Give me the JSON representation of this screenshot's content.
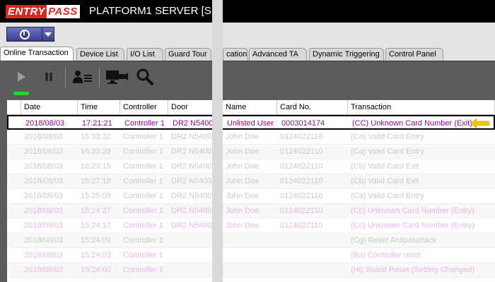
{
  "title": {
    "brand_entry": "ENTRY",
    "brand_pass": "PASS",
    "server": "PLATFORM1 SERVER [S"
  },
  "tabs": [
    {
      "label": "Online Transaction",
      "active": true
    },
    {
      "label": "Device List"
    },
    {
      "label": "I/O List"
    },
    {
      "label": "Guard Tour"
    },
    {
      "label": "cation"
    },
    {
      "label": "Advanced TA"
    },
    {
      "label": "Dynamic Triggering"
    },
    {
      "label": "Control Panel"
    }
  ],
  "columns": [
    "Date",
    "Time",
    "Controller",
    "Door",
    "Name",
    "Card No.",
    "Transaction"
  ],
  "rows": [
    {
      "date": "2018/08/03",
      "time": "17:21:21",
      "controller": "Controller 1",
      "door": "DR2 N5400",
      "name": "Unlisted User",
      "card": "0003014174",
      "transaction": "(CC) Unknown Card Number (Exit)",
      "style": "selected"
    },
    {
      "date": "2018/08/03",
      "time": "16:33:32",
      "controller": "Controller 1",
      "door": "DR2 N5400",
      "name": "John Doe",
      "card": "0124022110",
      "transaction": "(Ca) Valid Card Entry",
      "style": "grey"
    },
    {
      "date": "2018/08/03",
      "time": "16:33:28",
      "controller": "Controller 1",
      "door": "DR2 N5400",
      "name": "John Doe",
      "card": "0124022110",
      "transaction": "(Ca) Valid Card Entry",
      "style": "grey"
    },
    {
      "date": "2018/08/03",
      "time": "16:23:15",
      "controller": "Controller 1",
      "door": "DR2 N5400",
      "name": "John Doe",
      "card": "0124022110",
      "transaction": "(Cb) Valid Card Exit",
      "style": "grey"
    },
    {
      "date": "2018/08/03",
      "time": "15:27:18",
      "controller": "Controller 1",
      "door": "DR2 N5400",
      "name": "John Doe",
      "card": "0124022110",
      "transaction": "(Cb) Valid Card Exit",
      "style": "grey"
    },
    {
      "date": "2018/08/03",
      "time": "15:25:08",
      "controller": "Controller 1",
      "door": "DR2 N5400",
      "name": "John Doe",
      "card": "0124022110",
      "transaction": "(Ca) Valid Card Entry",
      "style": "grey"
    },
    {
      "date": "2018/08/03",
      "time": "15:24:27",
      "controller": "Controller 1",
      "door": "DR2 N5400",
      "name": "John Doe",
      "card": "0124022110",
      "transaction": "(Cc) Unknown Card Number (Entry)",
      "style": "pink"
    },
    {
      "date": "2018/08/03",
      "time": "15:24:17",
      "controller": "Controller 1",
      "door": "DR2 N5400",
      "name": "John Doe",
      "card": "0124022110",
      "transaction": "(Cc) Unknown Card Number (Entry)",
      "style": "pink"
    },
    {
      "date": "2018/08/03",
      "time": "15:24:09",
      "controller": "Controller 1",
      "door": "",
      "name": "",
      "card": "",
      "transaction": "(Cg) Reset Antipassback",
      "style": "grey"
    },
    {
      "date": "2018/08/03",
      "time": "15:24:03",
      "controller": "Controller 1",
      "door": "",
      "name": "",
      "card": "",
      "transaction": "(Ba) Controller reset",
      "style": "pink"
    },
    {
      "date": "2018/08/03",
      "time": "15:24:00",
      "controller": "Controller 1",
      "door": "",
      "name": "",
      "card": "",
      "transaction": "(Ht) Board Reset (Setting Changed)",
      "style": "pink"
    }
  ],
  "colors": {
    "selected_text": "#8a0a8a",
    "pink_text": "#e6b7e6",
    "grey_text": "#c9c9c9",
    "indicator": "#28d62a",
    "arrow": "#f0c400"
  },
  "icons": [
    "power-icon",
    "dropdown-arrow-icon",
    "play-icon",
    "pause-icon",
    "user-list-icon",
    "camera-monitor-icon",
    "search-icon",
    "pointer-arrow-icon"
  ]
}
